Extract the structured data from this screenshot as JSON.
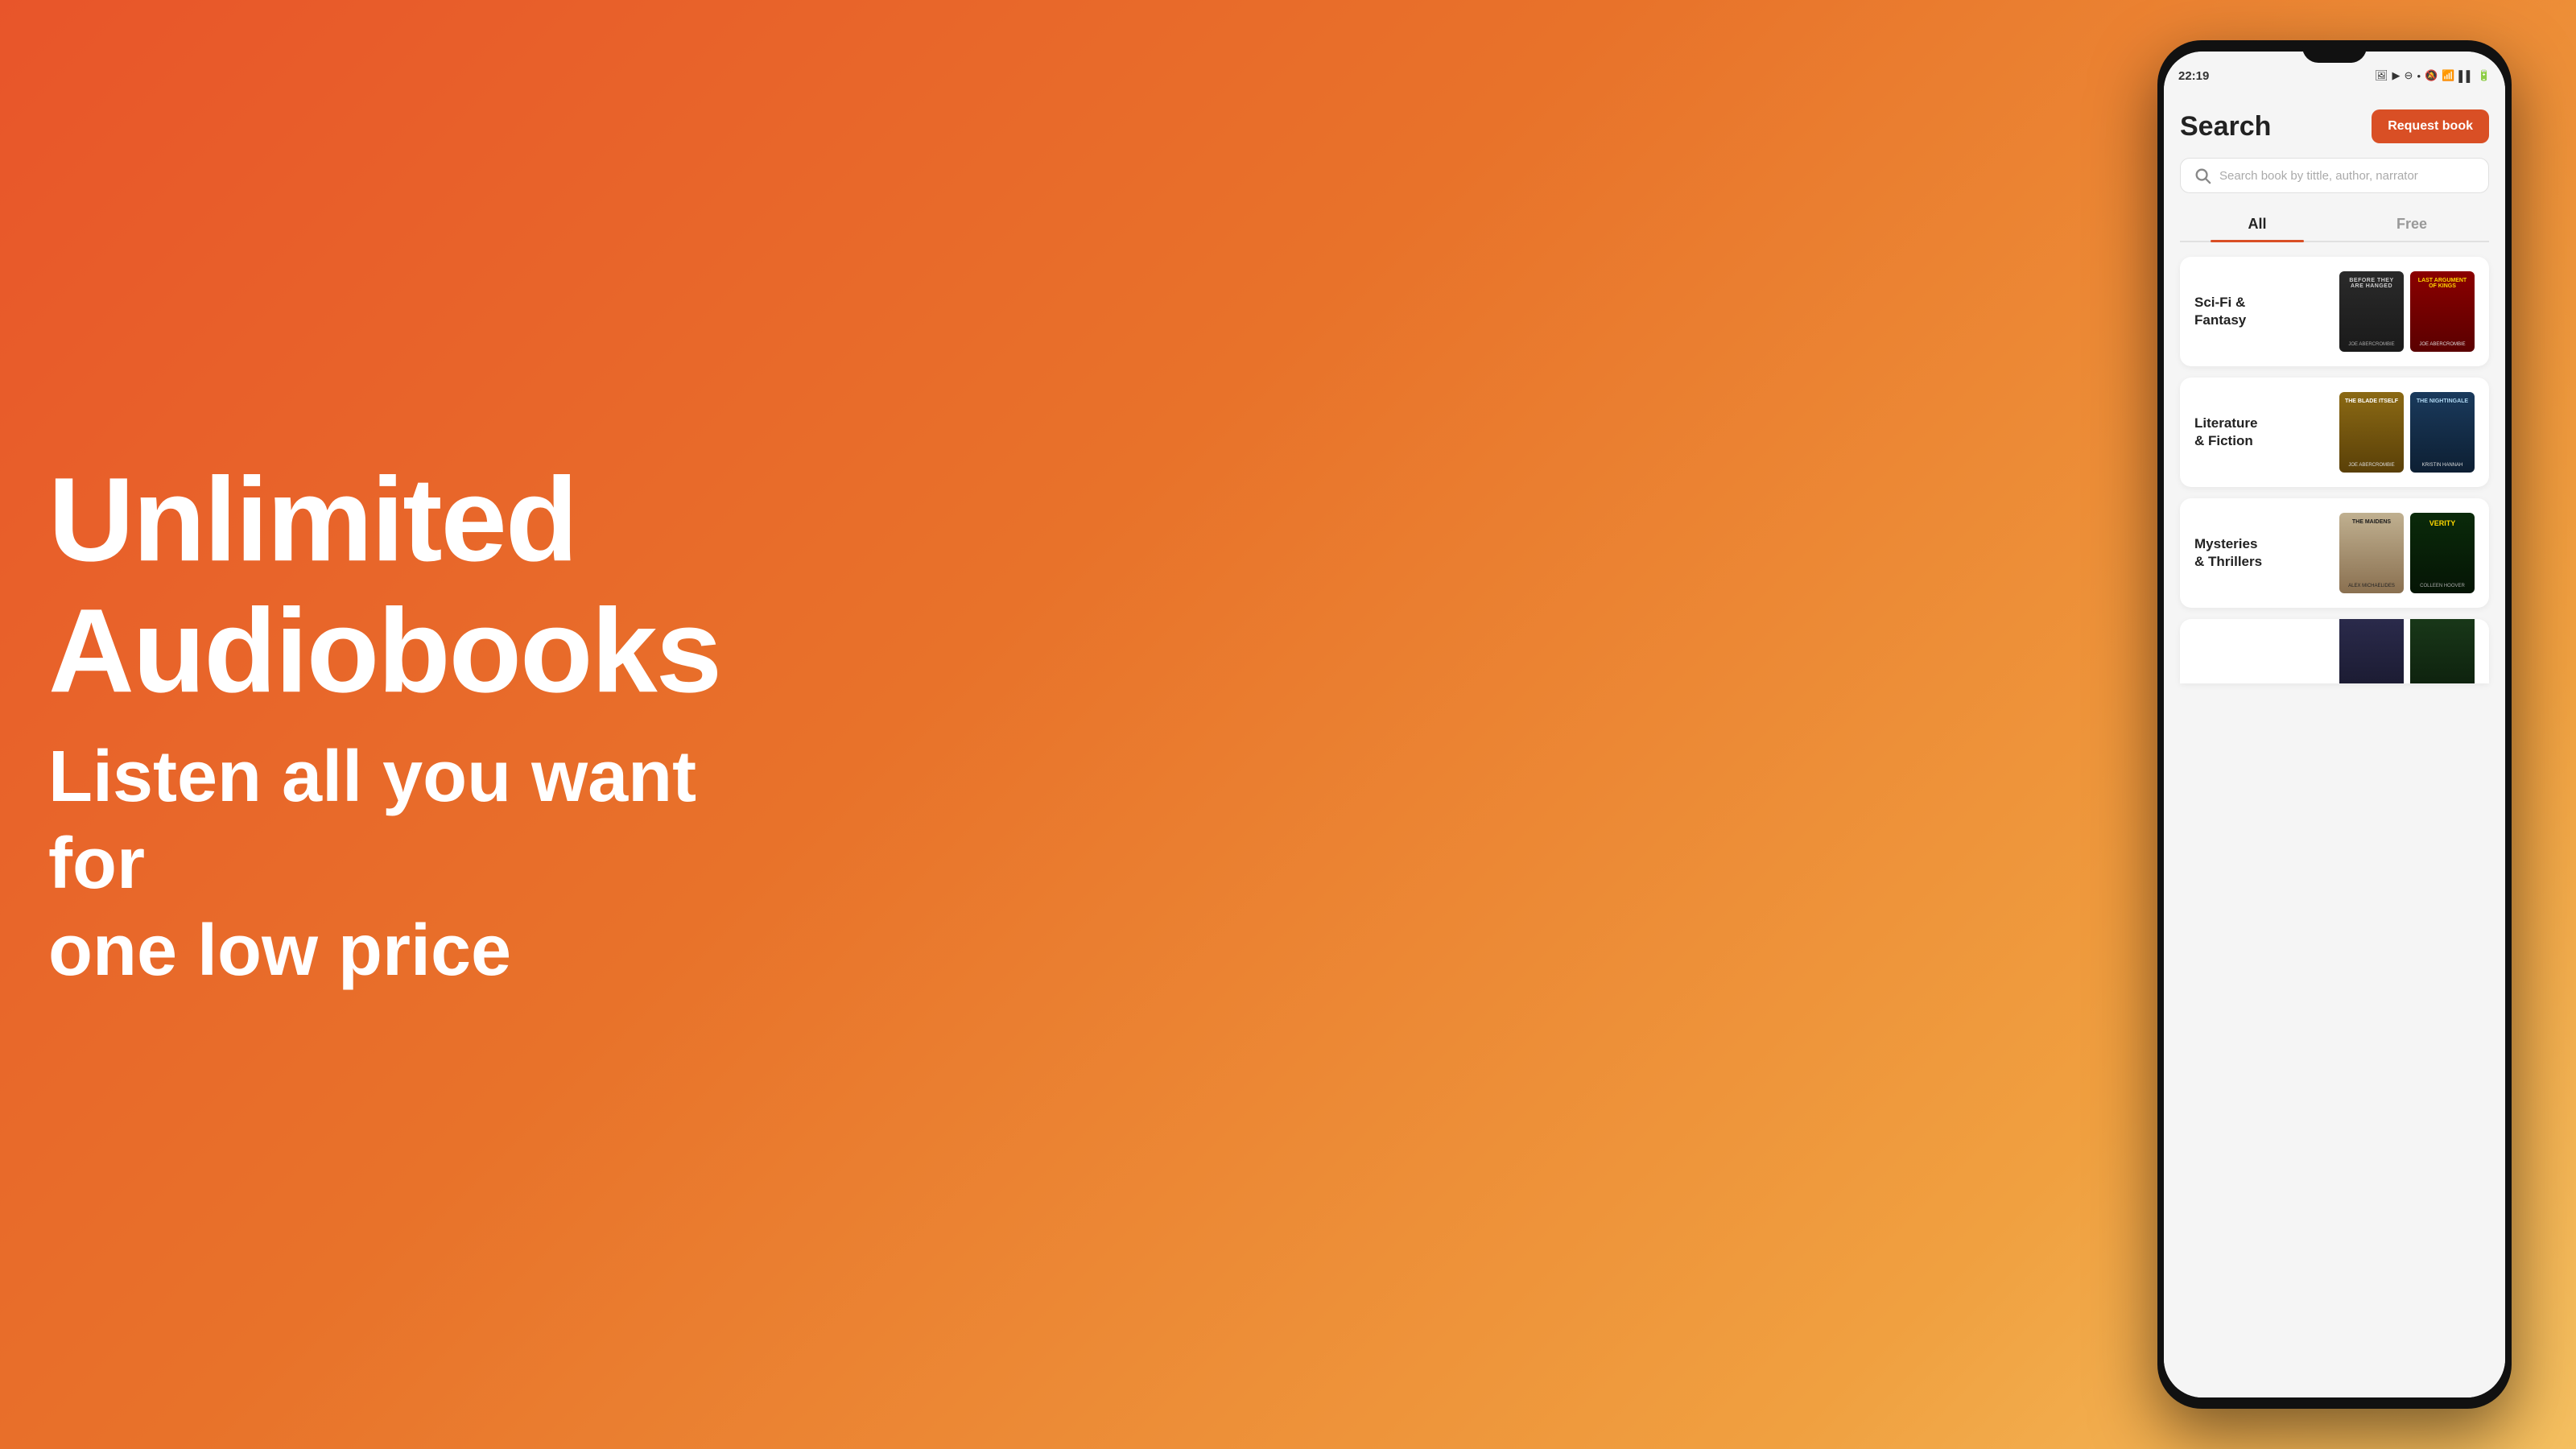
{
  "background": {
    "gradient_start": "#e8552a",
    "gradient_end": "#f5c060"
  },
  "left": {
    "headline": "Unlimited Audiobooks",
    "subheadline": "Listen all you want for\none low price"
  },
  "phone": {
    "status_bar": {
      "time": "22:19",
      "icons": "🔔 ▶ ⊖ •  🔕 📶 🔋"
    },
    "header": {
      "title": "Search",
      "request_button_label": "Request book"
    },
    "search": {
      "placeholder": "Search book by tittle, author, narrator"
    },
    "tabs": [
      {
        "label": "All",
        "active": true
      },
      {
        "label": "Free",
        "active": false
      }
    ],
    "categories": [
      {
        "name": "sci-fi-fantasy",
        "label": "Sci-Fi &\nFantasy",
        "books": [
          {
            "name": "before-they-are-hanged",
            "title": "Before They Are Hanged",
            "author": "Joe Abercrombie",
            "css_class": "book-before-hanged"
          },
          {
            "name": "last-argument-of-kings",
            "title": "Last Argument of Kings",
            "author": "Joe Abercrombie",
            "css_class": "book-last-arg"
          }
        ]
      },
      {
        "name": "literature-fiction",
        "label": "Literature\n& Fiction",
        "books": [
          {
            "name": "the-blade-itself",
            "title": "The Blade Itself",
            "author": "Joe Abercrombie",
            "css_class": "book-blade"
          },
          {
            "name": "the-nightingale",
            "title": "The Nightingale",
            "author": "Kristin Hannah",
            "css_class": "book-nightingale"
          }
        ]
      },
      {
        "name": "mysteries-thrillers",
        "label": "Mysteries\n& Thrillers",
        "books": [
          {
            "name": "the-maidens",
            "title": "The Maidens",
            "author": "Alex Michaelides",
            "css_class": "book-maidens"
          },
          {
            "name": "verity",
            "title": "Verity",
            "author": "Colleen Hoover",
            "css_class": "book-verity"
          }
        ]
      },
      {
        "name": "partial-category",
        "label": "",
        "books": [
          {
            "name": "book-partial-1",
            "title": "",
            "author": "",
            "css_class": "book-placeholder1"
          },
          {
            "name": "book-partial-2",
            "title": "",
            "author": "",
            "css_class": "book-placeholder2"
          }
        ]
      }
    ]
  }
}
